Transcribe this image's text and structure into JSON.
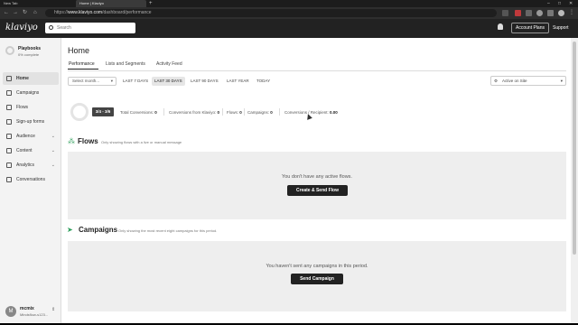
{
  "browser": {
    "tabs": [
      {
        "title": "New Tab"
      },
      {
        "title": "Home | Klaviyo"
      }
    ],
    "new_tab_glyph": "+",
    "url_host": "www.klaviyo.com",
    "url_path": "/dashboard/performance",
    "url_prefix": "https://"
  },
  "header": {
    "logo": "klaviyo",
    "search_placeholder": "Search",
    "account_plans": "Account Plans",
    "support": "Support"
  },
  "sidebar": {
    "playbooks_title": "Playbooks",
    "playbooks_sub": "0% complete",
    "items": [
      {
        "label": "Home",
        "icon": "home-icon",
        "active": true
      },
      {
        "label": "Campaigns",
        "icon": "campaigns-icon"
      },
      {
        "label": "Flows",
        "icon": "flows-icon"
      },
      {
        "label": "Sign-up forms",
        "icon": "forms-icon"
      },
      {
        "label": "Audience",
        "icon": "audience-icon",
        "expand": true
      },
      {
        "label": "Content",
        "icon": "content-icon",
        "expand": true
      },
      {
        "label": "Analytics",
        "icon": "analytics-icon",
        "expand": true
      },
      {
        "label": "Conversations",
        "icon": "conversations-icon"
      }
    ],
    "user_initial": "M",
    "user_name": "mcmix",
    "user_sub": "Mindsflow-s123..."
  },
  "main": {
    "title": "Home",
    "tabs": [
      "Performance",
      "Lists and Segments",
      "Activity Feed"
    ],
    "month_select": "Select month...",
    "ranges": [
      "LAST 7 DAYS",
      "LAST 30 DAYS",
      "LAST 90 DAYS",
      "LAST YEAR",
      "TODAY"
    ],
    "selected_range": "LAST 30 DAYS",
    "site_select": "Active on Site",
    "stats": {
      "pill": "3/4 - 3/6",
      "total_conversions_label": "Total Conversions:",
      "total_conversions": "0",
      "from_klaviyo_label": "Conversions from Klaviyo:",
      "from_klaviyo": "0",
      "flows_label": "Flows:",
      "flows": "0",
      "campaigns_label": "Campaigns:",
      "campaigns": "0",
      "per_recipient_label": "Conversions / Recipient:",
      "per_recipient": "0.00"
    },
    "flows": {
      "title": "Flows",
      "note": "Only showing flows with a live or manual message",
      "empty": "You don't have any active flows.",
      "button": "Create & Send Flow"
    },
    "campaigns": {
      "title": "Campaigns",
      "note": "Only showing the most recent eight campaigns for this period.",
      "empty": "You haven't sent any campaigns in this period.",
      "button": "Send Campaign"
    }
  }
}
